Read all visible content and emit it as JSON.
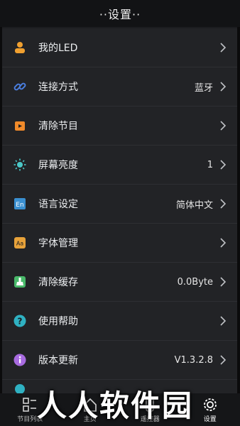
{
  "header": {
    "title": "··设置··"
  },
  "settings": {
    "items": [
      {
        "label": "我的LED",
        "value": ""
      },
      {
        "label": "连接方式",
        "value": "蓝牙"
      },
      {
        "label": "清除节目",
        "value": ""
      },
      {
        "label": "屏幕亮度",
        "value": "1"
      },
      {
        "label": "语言设定",
        "value": "简体中文"
      },
      {
        "label": "字体管理",
        "value": ""
      },
      {
        "label": "清除缓存",
        "value": "0.0Byte"
      },
      {
        "label": "使用帮助",
        "value": ""
      },
      {
        "label": "版本更新",
        "value": "V1.3.2.8"
      }
    ]
  },
  "tabbar": {
    "tabs": [
      {
        "label": "节目列表"
      },
      {
        "label": "主页"
      },
      {
        "label": "遥控器"
      },
      {
        "label": "设置"
      }
    ]
  },
  "watermark": {
    "text": "人人软件园"
  },
  "colors": {
    "user": "#f0a030",
    "link": "#4a7ee0",
    "clear": "#f08a2a",
    "brightness": "#4bc7c7",
    "language": "#3a8fd0",
    "font": "#e7a23a",
    "cache": "#49b96a",
    "help": "#2fb1c2",
    "update": "#a86be0"
  }
}
